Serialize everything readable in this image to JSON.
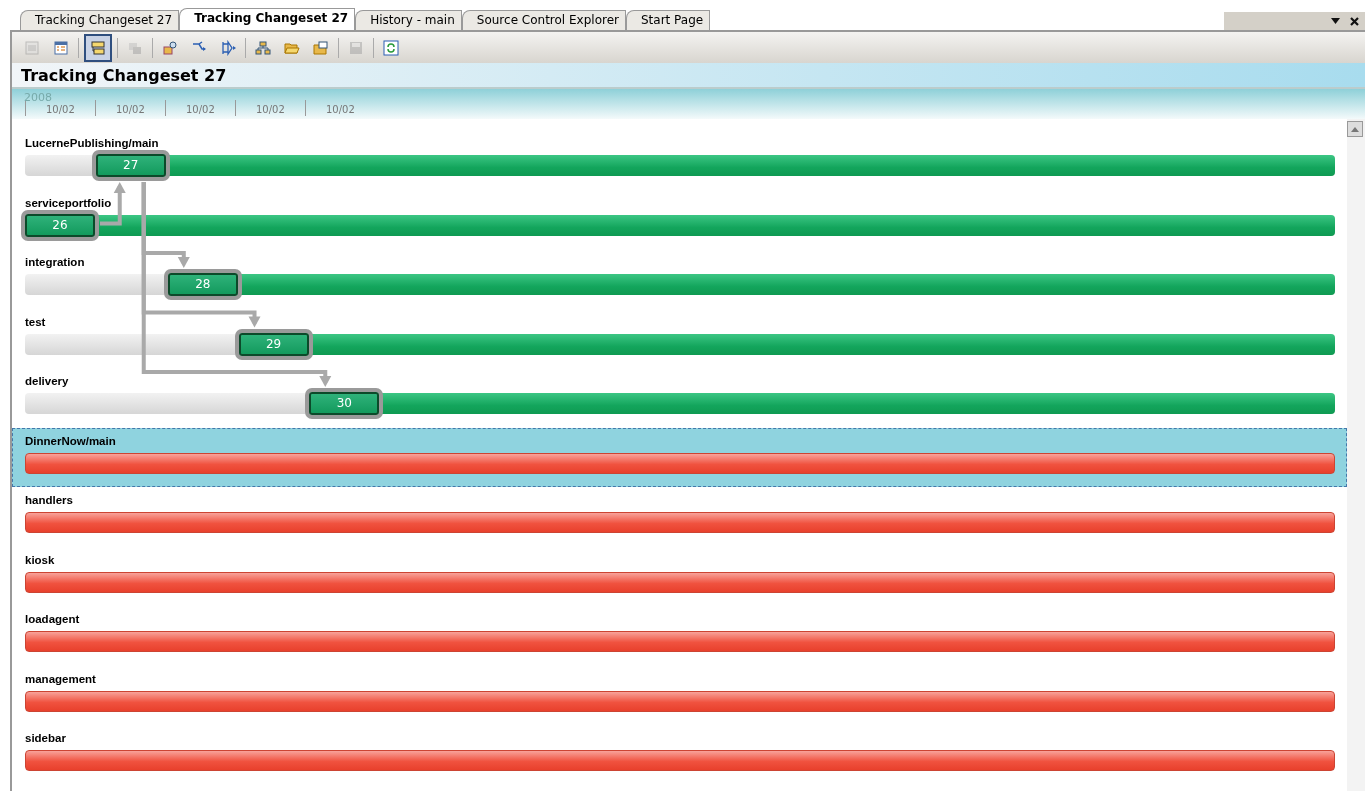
{
  "tabs": [
    {
      "label": "Tracking Changeset 27",
      "selected": false
    },
    {
      "label": "Tracking Changeset 27",
      "selected": true
    },
    {
      "label": "History - main",
      "selected": false
    },
    {
      "label": "Source Control Explorer",
      "selected": false
    },
    {
      "label": "Start Page",
      "selected": false
    }
  ],
  "toolbar": [
    {
      "kind": "list",
      "selected": false,
      "disabled": true
    },
    {
      "kind": "details",
      "selected": false,
      "disabled": false
    },
    {
      "kind": "timeline",
      "selected": true,
      "disabled": false
    },
    {
      "kind": "stack",
      "selected": false,
      "disabled": true
    },
    {
      "kind": "find",
      "selected": false,
      "disabled": false
    },
    {
      "kind": "branch",
      "selected": false,
      "disabled": false
    },
    {
      "kind": "merge",
      "selected": false,
      "disabled": false
    },
    {
      "kind": "hierarchy",
      "selected": false,
      "disabled": false
    },
    {
      "kind": "open",
      "selected": false,
      "disabled": false
    },
    {
      "kind": "properties",
      "selected": false,
      "disabled": false
    },
    {
      "kind": "save",
      "selected": false,
      "disabled": true
    },
    {
      "kind": "refresh",
      "selected": false,
      "disabled": false
    }
  ],
  "title": "Tracking Changeset 27",
  "timeline": {
    "year": "2008",
    "dates": [
      "10/02",
      "10/02",
      "10/02",
      "10/02",
      "10/02"
    ]
  },
  "branches": [
    {
      "name": "LucernePublishing/main",
      "kind": "changed",
      "selected": false,
      "changeset": "27",
      "level": 0.054
    },
    {
      "name": "serviceportfolio",
      "kind": "changed",
      "selected": false,
      "changeset": "26",
      "merges_up": true
    },
    {
      "name": "integration",
      "kind": "changed",
      "selected": false,
      "changeset": "28",
      "level": 0.109,
      "merged_down": true
    },
    {
      "name": "test",
      "kind": "changed",
      "selected": false,
      "changeset": "29",
      "level": 0.163,
      "merged_down": true
    },
    {
      "name": "delivery",
      "kind": "changed",
      "selected": false,
      "changeset": "30",
      "level": 0.217,
      "merged_down": true
    },
    {
      "name": "DinnerNow/main",
      "kind": "missing",
      "selected": true
    },
    {
      "name": "handlers",
      "kind": "missing",
      "selected": false
    },
    {
      "name": "kiosk",
      "kind": "missing",
      "selected": false
    },
    {
      "name": "loadagent",
      "kind": "missing",
      "selected": false
    },
    {
      "name": "management",
      "kind": "missing",
      "selected": false
    },
    {
      "name": "sidebar",
      "kind": "missing",
      "selected": false
    }
  ]
}
